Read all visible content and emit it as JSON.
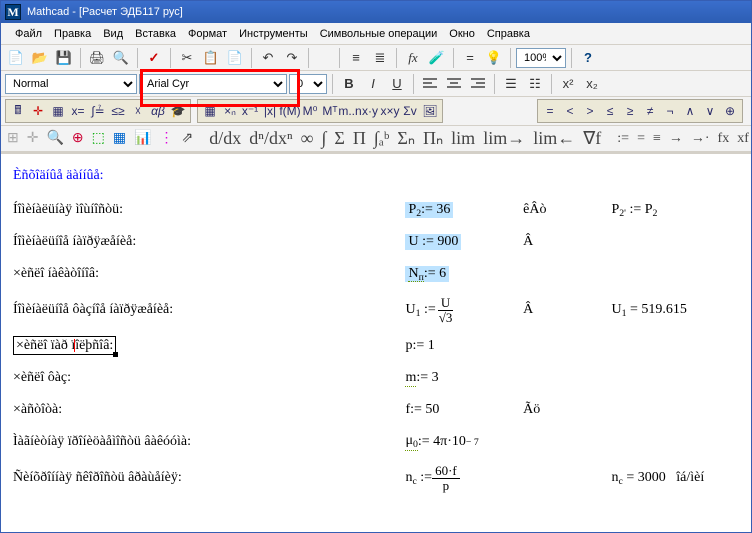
{
  "window": {
    "title": "Mathcad - [Расчет ЭДБ117 рус]"
  },
  "menu": {
    "file": "Файл",
    "edit": "Правка",
    "view": "Вид",
    "insert": "Вставка",
    "format": "Формат",
    "tools": "Инструменты",
    "symbolic": "Символьные операции",
    "window": "Окно",
    "help": "Справка"
  },
  "toolbar_main": {
    "zoom": "100%"
  },
  "toolbar_format": {
    "style": "Normal",
    "font": "Arial Cyr",
    "size": "0"
  },
  "section_header": "Èñõîäíûå äàííûå:",
  "rows": {
    "r1": {
      "label": "Íîìèíàëüíàÿ ìîùíîñòü:",
      "eq_pre": "P",
      "eq_sub": "2",
      "eq_rhs": ":= 36",
      "unit": "êÂò",
      "res_pre": "P",
      "res_sub": "2'",
      "res_rhs": " := P",
      "res_sub2": "2"
    },
    "r2": {
      "label": "Íîìèíàëüíîå íàïðÿæåíèå:",
      "eq_pre": "U ",
      "eq_rhs": ":= 900",
      "unit": "Â"
    },
    "r3": {
      "label": "×èñëî íàêàòîíîâ:",
      "eq_pre": "N",
      "eq_sub": "п",
      "eq_rhs": ":= 6"
    },
    "r4": {
      "label": "Íîìèíàëüíîå ôàçíîå íàïðÿæåíèå:",
      "eq_pre": "U",
      "eq_sub": "1",
      "eq_rhs": " := ",
      "unit": "Â",
      "res_pre": "U",
      "res_sub": "1",
      "res_rhs": " = 519.615"
    },
    "r5": {
      "label": "×èñëî ïàð ïîëþñîâ:",
      "eq_pre": "p ",
      "eq_rhs": ":= 1"
    },
    "r6": {
      "label": "×èñëî ôàç:",
      "eq_pre": "m",
      "eq_rhs": ":= 3"
    },
    "r7": {
      "label": "×àñòîòà:",
      "eq_pre": "f ",
      "eq_rhs": ":= 50",
      "unit": "Ãö"
    },
    "r8": {
      "label": "Ìàãíèòíàÿ ïðîíèöàåìîñòü âàêóóìà:",
      "eq_pre": "μ",
      "eq_sub": "0",
      "eq_rhs": ":= 4π·10",
      "eq_sup": "− 7"
    },
    "r9": {
      "label": "Ñèíõðîííàÿ ñêîðîñòü âðàùåíèÿ:",
      "eq_pre": "n",
      "eq_sub": "c",
      "eq_rhs": " := ",
      "res_pre": "n",
      "res_sub": "c",
      "res_rhs": " = 3000",
      "res_unit": "îá/ìèí"
    }
  }
}
